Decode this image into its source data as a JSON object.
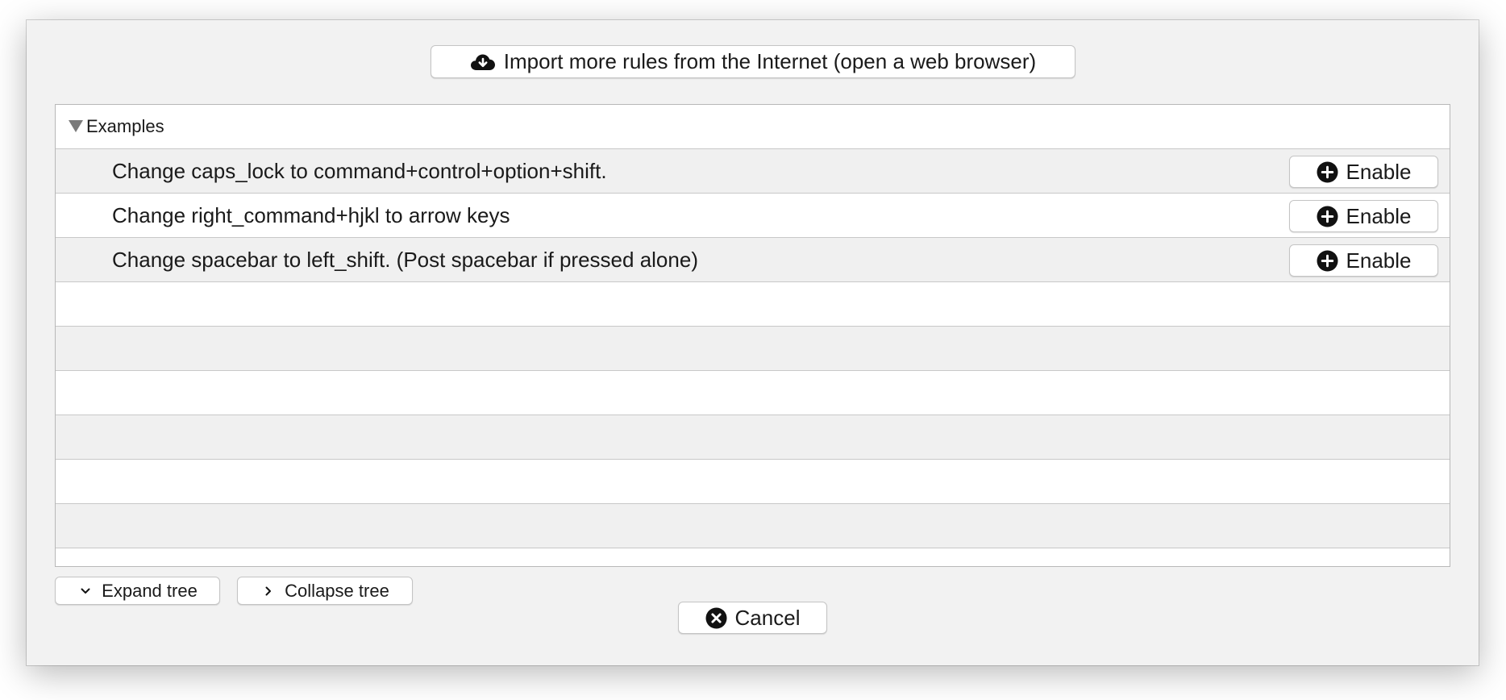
{
  "toolbar": {
    "import_label": "Import more rules from the Internet (open a web browser)",
    "import_icon": "cloud-download-icon"
  },
  "tree": {
    "group": {
      "label": "Examples",
      "expanded": true
    },
    "rules": [
      {
        "label": "Change caps_lock to command+control+option+shift.",
        "button_label": "Enable"
      },
      {
        "label": "Change right_command+hjkl to arrow keys",
        "button_label": "Enable"
      },
      {
        "label": "Change spacebar to left_shift. (Post spacebar if pressed alone)",
        "button_label": "Enable"
      }
    ]
  },
  "footer": {
    "expand_label": "Expand tree",
    "collapse_label": "Collapse tree",
    "cancel_label": "Cancel"
  },
  "colors": {
    "window_bg": "#f2f2f2",
    "row_alt_bg": "#f0f0f0",
    "row_bg": "#ffffff",
    "icon_fill": "#111111"
  }
}
